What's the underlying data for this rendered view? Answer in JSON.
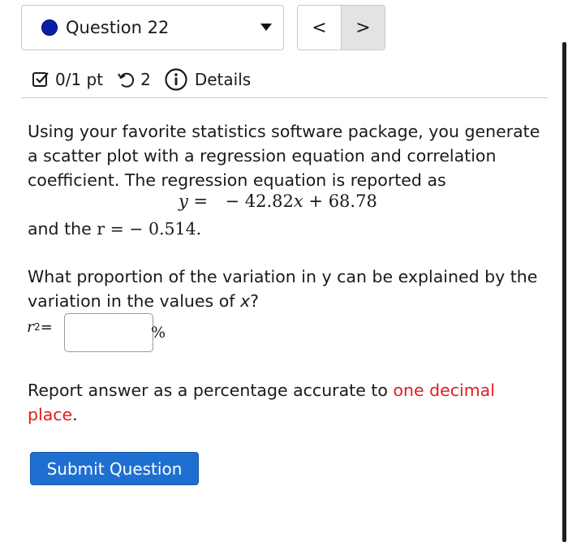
{
  "question_selector": {
    "label": "Question 22",
    "status_color": "#0b1ea8"
  },
  "nav": {
    "prev_glyph": "<",
    "next_glyph": ">"
  },
  "meta": {
    "score": "0/1 pt",
    "attempts": "2",
    "details_label": "Details"
  },
  "question": {
    "intro": "Using your favorite statistics software package, you generate a scatter plot with a regression equation and correlation coefficient. The regression equation is reported as",
    "equation_lhs": "y =",
    "equation_rhs_prefix": "− 42.82",
    "equation_var": "x",
    "equation_rhs_suffix": " + 68.78",
    "r_prefix": "and the ",
    "r_math": "r =  − 0.514.",
    "prompt_part1": "What proportion of the variation in y can be explained by the variation in the values of ",
    "prompt_var": "x",
    "prompt_part2": "?",
    "answer_label_var": "r",
    "answer_label_sup": "2",
    "answer_label_eq": " =",
    "answer_value": "",
    "answer_unit": "%",
    "instruction_prefix": "Report answer as a percentage accurate to ",
    "instruction_highlight": "one decimal place",
    "instruction_suffix": "."
  },
  "submit": {
    "label": "Submit Question"
  },
  "colors": {
    "submit_bg": "#1f6fd1",
    "highlight_red": "#e01d1d"
  }
}
